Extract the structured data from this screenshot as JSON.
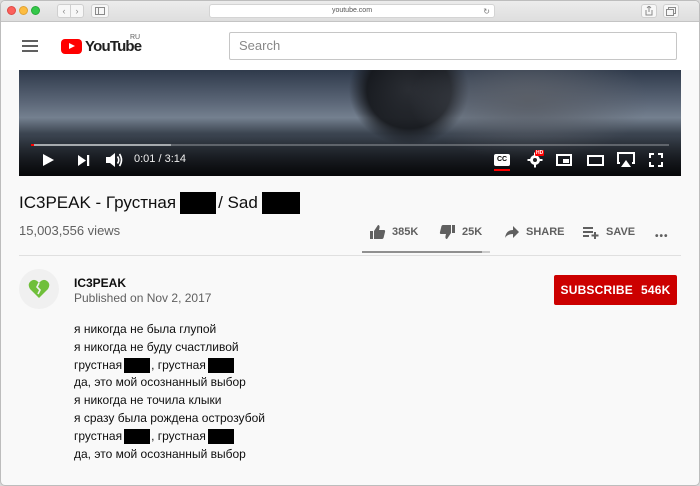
{
  "browser": {
    "url": "youtube.com"
  },
  "header": {
    "logo_text": "YouTube",
    "logo_region": "RU",
    "search_placeholder": "Search"
  },
  "player": {
    "time": "0:01 / 3:14",
    "played_fraction": 0.005,
    "buffered_fraction": 0.22,
    "cc_label": "CC",
    "hd_badge": "HD"
  },
  "video": {
    "title_part1": "IC3PEAK - Грустная",
    "title_part2": "/ Sad",
    "views": "15,003,556 views",
    "likes": "385K",
    "dislikes": "25K",
    "like_fraction": 0.94,
    "share_label": "SHARE",
    "save_label": "SAVE",
    "more_label": "•••"
  },
  "channel": {
    "name": "IC3PEAK",
    "published": "Published on Nov 2, 2017",
    "subscribe_label": "SUBSCRIBE",
    "subscriber_count": "546K",
    "accent": "#cc0000"
  },
  "description": {
    "lines": [
      "я никогда не была глупой",
      "я никогда не буду счастливой",
      "грустная",
      ", грустная",
      "да, это мой осознанный выбор",
      "я никогда не точила клыки",
      "я сразу была рождена острозубой",
      "грустная",
      ", грустная",
      "да, это мой осознанный выбор"
    ]
  }
}
